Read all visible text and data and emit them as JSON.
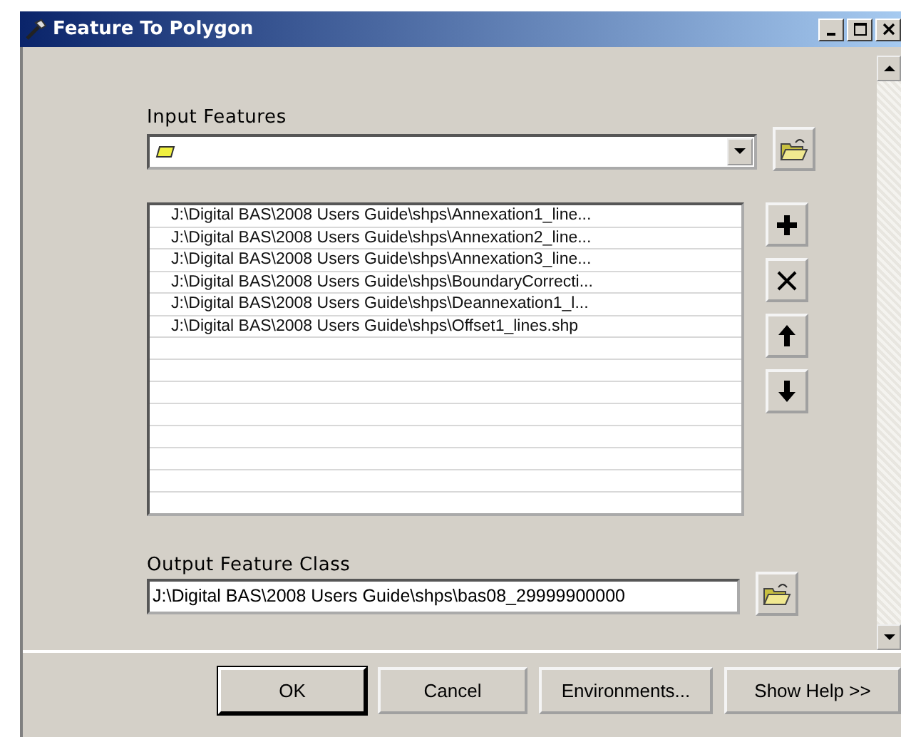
{
  "window": {
    "title": "Feature To Polygon"
  },
  "input_features": {
    "label": "Input Features"
  },
  "input_list": [
    "J:\\Digital BAS\\2008 Users Guide\\shps\\Annexation1_line...",
    "J:\\Digital BAS\\2008 Users Guide\\shps\\Annexation2_line...",
    "J:\\Digital BAS\\2008 Users Guide\\shps\\Annexation3_line...",
    "J:\\Digital BAS\\2008 Users Guide\\shps\\BoundaryCorrecti...",
    "J:\\Digital BAS\\2008 Users Guide\\shps\\Deannexation1_l...",
    "J:\\Digital BAS\\2008 Users Guide\\shps\\Offset1_lines.shp"
  ],
  "output_feature_class": {
    "label": "Output Feature Class",
    "value": "J:\\Digital BAS\\2008 Users Guide\\shps\\bas08_29999900000"
  },
  "buttons": [
    "OK",
    "Cancel",
    "Environments...",
    "Show Help >>"
  ]
}
